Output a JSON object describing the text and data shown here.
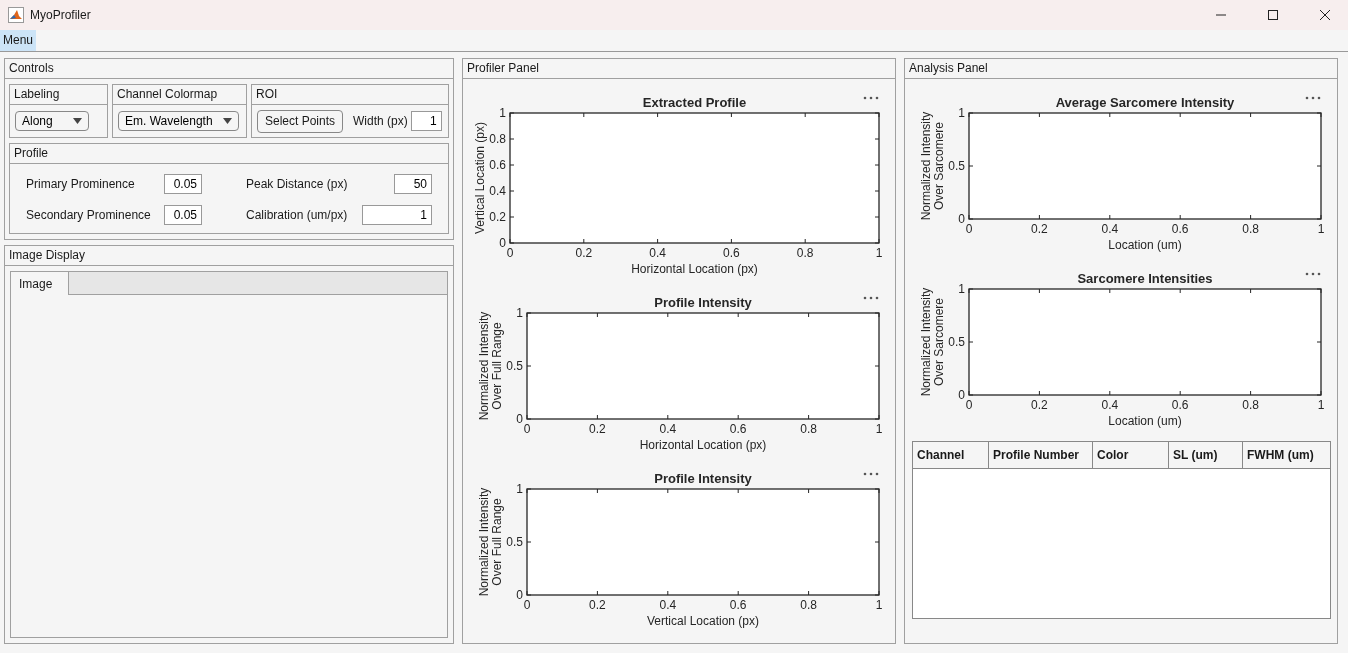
{
  "window": {
    "title": "MyoProfiler"
  },
  "menu": [
    {
      "label": "Menu",
      "selected": true
    }
  ],
  "controls": {
    "title": "Controls",
    "labeling": {
      "title": "Labeling",
      "value": "Along"
    },
    "colormap": {
      "title": "Channel Colormap",
      "value": "Em. Wavelength"
    },
    "roi": {
      "title": "ROI",
      "button": "Select Points",
      "width_label": "Width (px)",
      "width_value": "1"
    },
    "profile": {
      "title": "Profile",
      "fields": [
        {
          "label": "Primary Prominence",
          "value": "0.05"
        },
        {
          "label": "Peak Distance (px)",
          "value": "50"
        },
        {
          "label": "Secondary Prominence",
          "value": "0.05"
        },
        {
          "label": "Calibration (um/px)",
          "value": "1"
        }
      ]
    }
  },
  "image_display": {
    "title": "Image Display",
    "tabs": [
      {
        "label": "Image",
        "selected": true
      }
    ]
  },
  "profiler_panel": {
    "title": "Profiler Panel",
    "charts": [
      {
        "chart_data": {
          "type": "line",
          "title": "Extracted Profile",
          "xlabel": "Horizontal Location (px)",
          "ylabel": "Vertical Location (px)",
          "xlim": [
            0,
            1
          ],
          "ylim": [
            0,
            1
          ],
          "xticks": [
            0,
            0.2,
            0.4,
            0.6,
            0.8,
            1
          ],
          "yticks": [
            0,
            0.2,
            0.4,
            0.6,
            0.8,
            1
          ]
        }
      },
      {
        "chart_data": {
          "type": "line",
          "title": "Profile Intensity",
          "xlabel": "Horizontal Location (px)",
          "ylabel": "Normalized Intensity Over Full Range",
          "xlim": [
            0,
            1
          ],
          "ylim": [
            0,
            1
          ],
          "xticks": [
            0,
            0.2,
            0.4,
            0.6,
            0.8,
            1
          ],
          "yticks": [
            0,
            0.5,
            1
          ]
        }
      },
      {
        "chart_data": {
          "type": "line",
          "title": "Profile Intensity",
          "xlabel": "Vertical Location (px)",
          "ylabel": "Normalized Intensity Over Full Range",
          "xlim": [
            0,
            1
          ],
          "ylim": [
            0,
            1
          ],
          "xticks": [
            0,
            0.2,
            0.4,
            0.6,
            0.8,
            1
          ],
          "yticks": [
            0,
            0.5,
            1
          ]
        }
      }
    ]
  },
  "analysis_panel": {
    "title": "Analysis Panel",
    "charts": [
      {
        "chart_data": {
          "type": "line",
          "title": "Average Sarcomere Intensity",
          "xlabel": "Location (um)",
          "ylabel": "Normalized Intensity Over Sarcomere",
          "xlim": [
            0,
            1
          ],
          "ylim": [
            0,
            1
          ],
          "xticks": [
            0,
            0.2,
            0.4,
            0.6,
            0.8,
            1
          ],
          "yticks": [
            0,
            0.5,
            1
          ]
        }
      },
      {
        "chart_data": {
          "type": "line",
          "title": "Sarcomere Intensities",
          "xlabel": "Location (um)",
          "ylabel": "Normalized Intensity Over Sarcomere",
          "xlim": [
            0,
            1
          ],
          "ylim": [
            0,
            1
          ],
          "xticks": [
            0,
            0.2,
            0.4,
            0.6,
            0.8,
            1
          ],
          "yticks": [
            0,
            0.5,
            1
          ]
        }
      }
    ],
    "table": {
      "columns": [
        "Channel",
        "Profile Number",
        "Color",
        "SL (um)",
        "FWHM (um)"
      ]
    }
  }
}
